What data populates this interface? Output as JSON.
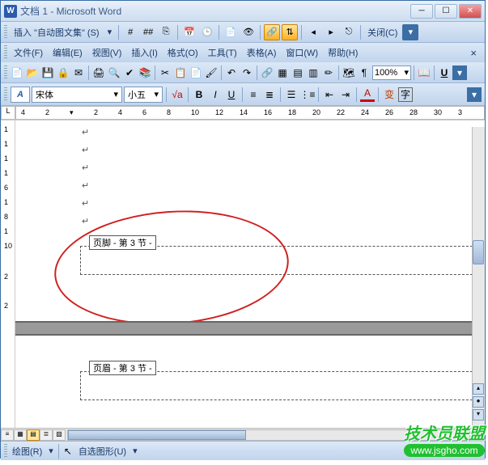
{
  "title": "文档 1 - Microsoft Word",
  "autotext": {
    "label": "插入 \"自动图文集\" (S)",
    "close": "关闭(C)"
  },
  "menu": {
    "file": "文件(F)",
    "edit": "编辑(E)",
    "view": "视图(V)",
    "insert": "插入(I)",
    "format": "格式(O)",
    "tools": "工具(T)",
    "table": "表格(A)",
    "window": "窗口(W)",
    "help": "帮助(H)"
  },
  "std": {
    "zoom": "100%"
  },
  "fmt": {
    "style": "A",
    "font": "宋体",
    "size": "小五",
    "bold": "B",
    "italic": "I",
    "underline": "U",
    "fontcolor": "A",
    "char": "字"
  },
  "ruler": {
    "corner": "L",
    "marks": [
      "4",
      "2",
      "",
      "2",
      "4",
      "6",
      "8",
      "10",
      "12",
      "14",
      "16",
      "18",
      "20",
      "22",
      "24",
      "26",
      "28",
      "30",
      "3"
    ],
    "vmarks": [
      "1",
      "1",
      "1",
      "1",
      "6",
      "1",
      "8",
      "1",
      "10",
      "",
      "2",
      "",
      "2"
    ]
  },
  "doc": {
    "para": "↵",
    "footer_label": "页脚 - 第 3 节 -",
    "header_label": "页眉 - 第 3 节 -"
  },
  "draw": {
    "label": "绘图(R)",
    "autoshape": "自选图形(U)"
  },
  "watermark": {
    "text": "技术员联盟",
    "url": "www.jsgho.com"
  }
}
